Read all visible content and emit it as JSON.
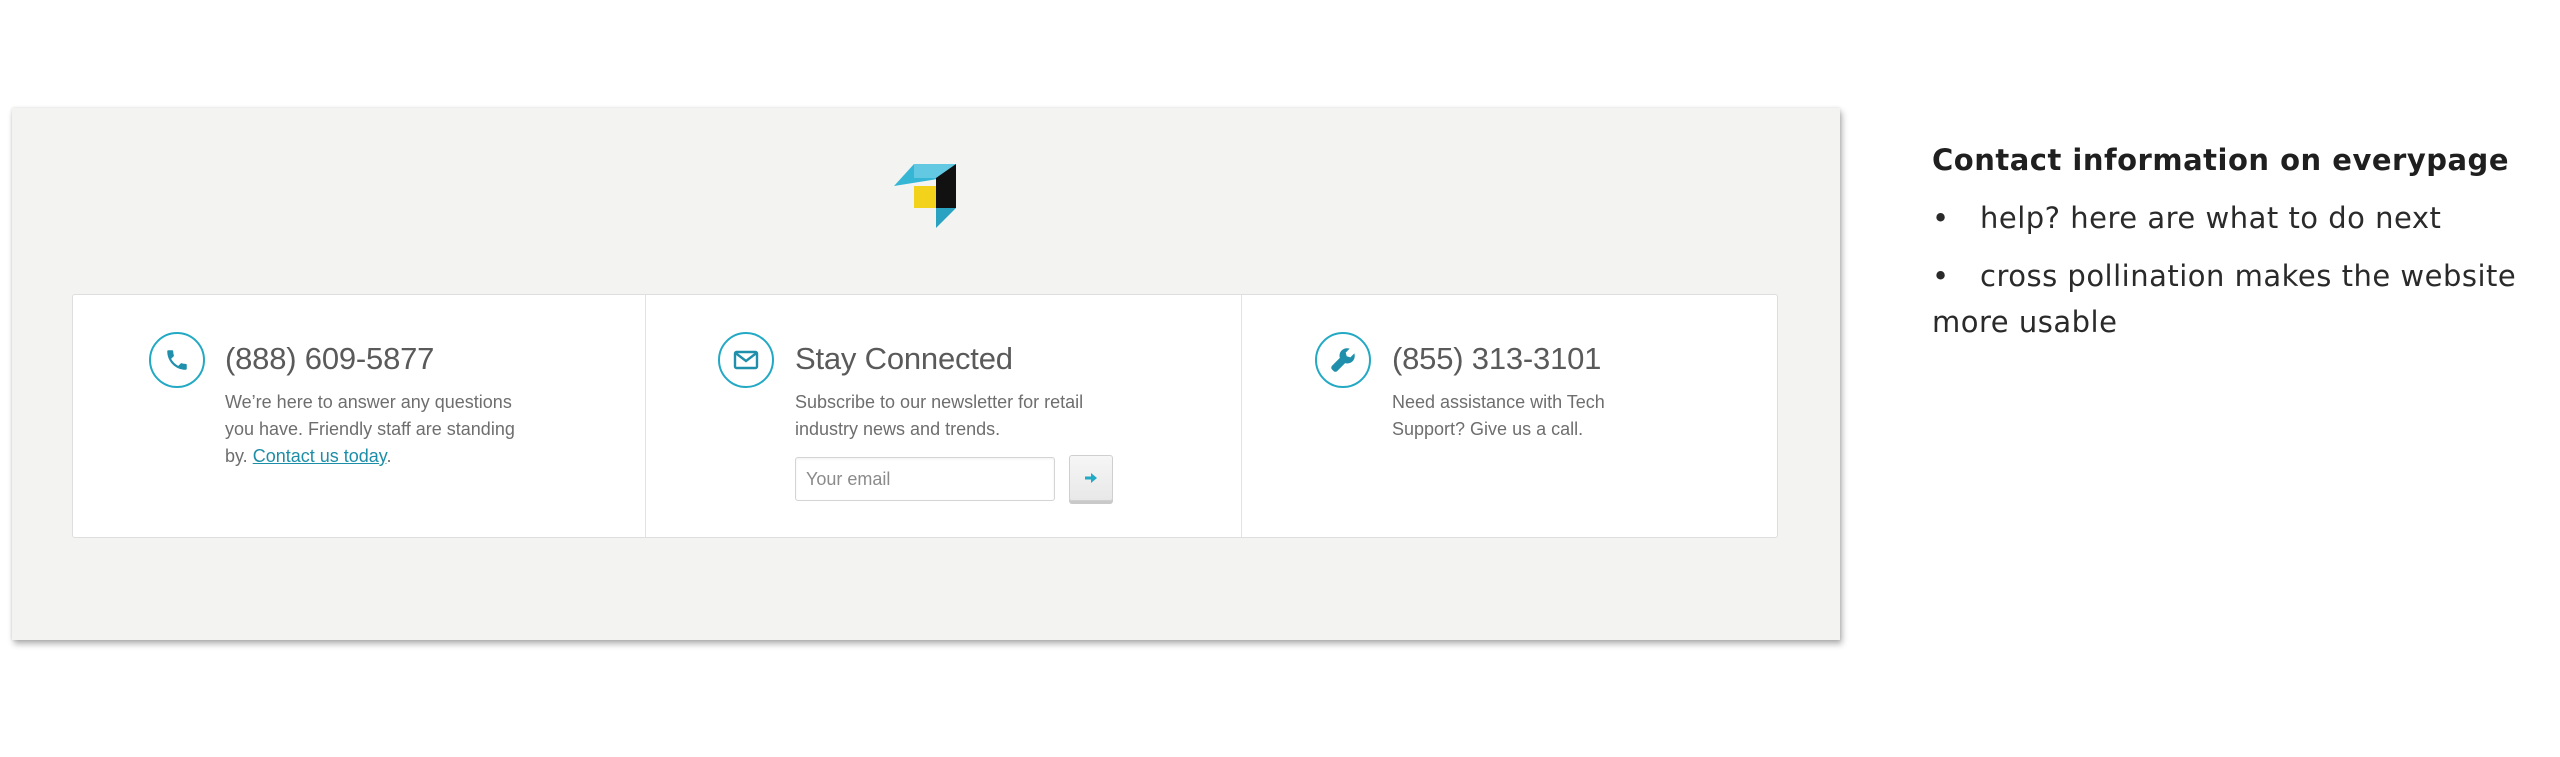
{
  "footer": {
    "columns": [
      {
        "title": "(888) 609-5877",
        "description": "We’re here to answer any questions you have. Friendly staff are standing by.",
        "link_text": "Contact us today",
        "link_suffix": ".",
        "icon": "phone-icon"
      },
      {
        "title": "Stay Connected",
        "description": "Subscribe to our newsletter for retail industry news and trends.",
        "email_placeholder": "Your email",
        "submit_icon": "arrow-right-icon",
        "icon": "envelope-icon"
      },
      {
        "title": "(855) 313-3101",
        "description": "Need assistance with Tech Support? Give us a call.",
        "icon": "wrench-icon"
      }
    ]
  },
  "notes": {
    "heading": "Contact information on everypage",
    "bullet_char": "•",
    "items": [
      "help? here are what to do next",
      "cross pollination makes the website more usable"
    ]
  },
  "colors": {
    "accent": "#23a9c4",
    "panel_background": "#f3f3f1",
    "logo_cyan": "#35b6d5",
    "logo_yellow": "#f2d21b",
    "logo_black": "#111111"
  }
}
